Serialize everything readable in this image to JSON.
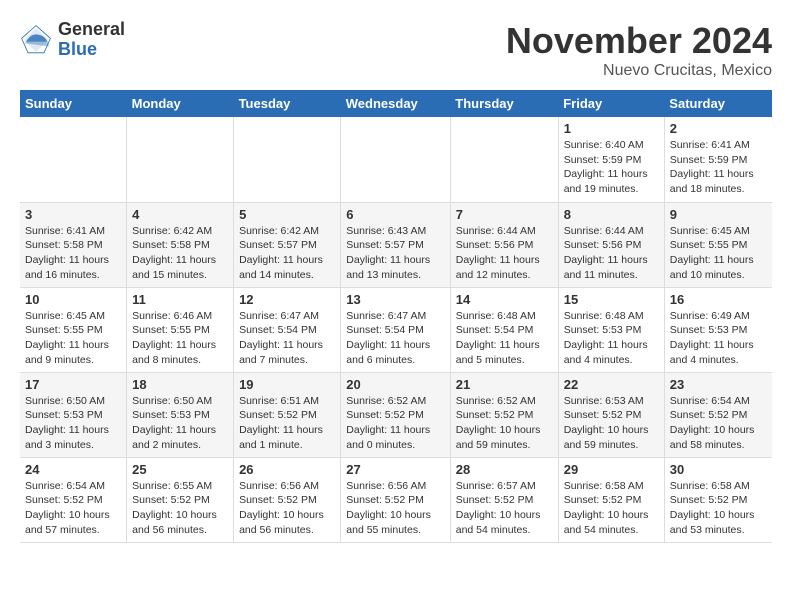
{
  "header": {
    "logo_general": "General",
    "logo_blue": "Blue",
    "month_title": "November 2024",
    "location": "Nuevo Crucitas, Mexico"
  },
  "weekdays": [
    "Sunday",
    "Monday",
    "Tuesday",
    "Wednesday",
    "Thursday",
    "Friday",
    "Saturday"
  ],
  "weeks": [
    [
      {
        "day": "",
        "empty": true
      },
      {
        "day": "",
        "empty": true
      },
      {
        "day": "",
        "empty": true
      },
      {
        "day": "",
        "empty": true
      },
      {
        "day": "",
        "empty": true
      },
      {
        "day": "1",
        "sunrise": "Sunrise: 6:40 AM",
        "sunset": "Sunset: 5:59 PM",
        "daylight": "Daylight: 11 hours and 19 minutes."
      },
      {
        "day": "2",
        "sunrise": "Sunrise: 6:41 AM",
        "sunset": "Sunset: 5:59 PM",
        "daylight": "Daylight: 11 hours and 18 minutes."
      }
    ],
    [
      {
        "day": "3",
        "sunrise": "Sunrise: 6:41 AM",
        "sunset": "Sunset: 5:58 PM",
        "daylight": "Daylight: 11 hours and 16 minutes."
      },
      {
        "day": "4",
        "sunrise": "Sunrise: 6:42 AM",
        "sunset": "Sunset: 5:58 PM",
        "daylight": "Daylight: 11 hours and 15 minutes."
      },
      {
        "day": "5",
        "sunrise": "Sunrise: 6:42 AM",
        "sunset": "Sunset: 5:57 PM",
        "daylight": "Daylight: 11 hours and 14 minutes."
      },
      {
        "day": "6",
        "sunrise": "Sunrise: 6:43 AM",
        "sunset": "Sunset: 5:57 PM",
        "daylight": "Daylight: 11 hours and 13 minutes."
      },
      {
        "day": "7",
        "sunrise": "Sunrise: 6:44 AM",
        "sunset": "Sunset: 5:56 PM",
        "daylight": "Daylight: 11 hours and 12 minutes."
      },
      {
        "day": "8",
        "sunrise": "Sunrise: 6:44 AM",
        "sunset": "Sunset: 5:56 PM",
        "daylight": "Daylight: 11 hours and 11 minutes."
      },
      {
        "day": "9",
        "sunrise": "Sunrise: 6:45 AM",
        "sunset": "Sunset: 5:55 PM",
        "daylight": "Daylight: 11 hours and 10 minutes."
      }
    ],
    [
      {
        "day": "10",
        "sunrise": "Sunrise: 6:45 AM",
        "sunset": "Sunset: 5:55 PM",
        "daylight": "Daylight: 11 hours and 9 minutes."
      },
      {
        "day": "11",
        "sunrise": "Sunrise: 6:46 AM",
        "sunset": "Sunset: 5:55 PM",
        "daylight": "Daylight: 11 hours and 8 minutes."
      },
      {
        "day": "12",
        "sunrise": "Sunrise: 6:47 AM",
        "sunset": "Sunset: 5:54 PM",
        "daylight": "Daylight: 11 hours and 7 minutes."
      },
      {
        "day": "13",
        "sunrise": "Sunrise: 6:47 AM",
        "sunset": "Sunset: 5:54 PM",
        "daylight": "Daylight: 11 hours and 6 minutes."
      },
      {
        "day": "14",
        "sunrise": "Sunrise: 6:48 AM",
        "sunset": "Sunset: 5:54 PM",
        "daylight": "Daylight: 11 hours and 5 minutes."
      },
      {
        "day": "15",
        "sunrise": "Sunrise: 6:48 AM",
        "sunset": "Sunset: 5:53 PM",
        "daylight": "Daylight: 11 hours and 4 minutes."
      },
      {
        "day": "16",
        "sunrise": "Sunrise: 6:49 AM",
        "sunset": "Sunset: 5:53 PM",
        "daylight": "Daylight: 11 hours and 4 minutes."
      }
    ],
    [
      {
        "day": "17",
        "sunrise": "Sunrise: 6:50 AM",
        "sunset": "Sunset: 5:53 PM",
        "daylight": "Daylight: 11 hours and 3 minutes."
      },
      {
        "day": "18",
        "sunrise": "Sunrise: 6:50 AM",
        "sunset": "Sunset: 5:53 PM",
        "daylight": "Daylight: 11 hours and 2 minutes."
      },
      {
        "day": "19",
        "sunrise": "Sunrise: 6:51 AM",
        "sunset": "Sunset: 5:52 PM",
        "daylight": "Daylight: 11 hours and 1 minute."
      },
      {
        "day": "20",
        "sunrise": "Sunrise: 6:52 AM",
        "sunset": "Sunset: 5:52 PM",
        "daylight": "Daylight: 11 hours and 0 minutes."
      },
      {
        "day": "21",
        "sunrise": "Sunrise: 6:52 AM",
        "sunset": "Sunset: 5:52 PM",
        "daylight": "Daylight: 10 hours and 59 minutes."
      },
      {
        "day": "22",
        "sunrise": "Sunrise: 6:53 AM",
        "sunset": "Sunset: 5:52 PM",
        "daylight": "Daylight: 10 hours and 59 minutes."
      },
      {
        "day": "23",
        "sunrise": "Sunrise: 6:54 AM",
        "sunset": "Sunset: 5:52 PM",
        "daylight": "Daylight: 10 hours and 58 minutes."
      }
    ],
    [
      {
        "day": "24",
        "sunrise": "Sunrise: 6:54 AM",
        "sunset": "Sunset: 5:52 PM",
        "daylight": "Daylight: 10 hours and 57 minutes."
      },
      {
        "day": "25",
        "sunrise": "Sunrise: 6:55 AM",
        "sunset": "Sunset: 5:52 PM",
        "daylight": "Daylight: 10 hours and 56 minutes."
      },
      {
        "day": "26",
        "sunrise": "Sunrise: 6:56 AM",
        "sunset": "Sunset: 5:52 PM",
        "daylight": "Daylight: 10 hours and 56 minutes."
      },
      {
        "day": "27",
        "sunrise": "Sunrise: 6:56 AM",
        "sunset": "Sunset: 5:52 PM",
        "daylight": "Daylight: 10 hours and 55 minutes."
      },
      {
        "day": "28",
        "sunrise": "Sunrise: 6:57 AM",
        "sunset": "Sunset: 5:52 PM",
        "daylight": "Daylight: 10 hours and 54 minutes."
      },
      {
        "day": "29",
        "sunrise": "Sunrise: 6:58 AM",
        "sunset": "Sunset: 5:52 PM",
        "daylight": "Daylight: 10 hours and 54 minutes."
      },
      {
        "day": "30",
        "sunrise": "Sunrise: 6:58 AM",
        "sunset": "Sunset: 5:52 PM",
        "daylight": "Daylight: 10 hours and 53 minutes."
      }
    ]
  ]
}
